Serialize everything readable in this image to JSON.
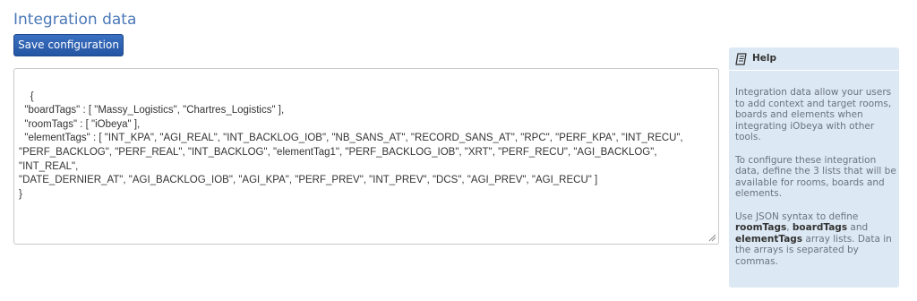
{
  "page": {
    "title": "Integration data"
  },
  "toolbar": {
    "save_label": "Save configuration"
  },
  "editor": {
    "value": "{\n  \"boardTags\" : [ \"Massy_Logistics\", \"Chartres_Logistics\" ],\n  \"roomTags\" : [ \"iObeya\" ],\n  \"elementTags\" : [ \"INT_KPA\", \"AGI_REAL\", \"INT_BACKLOG_IOB\", \"NB_SANS_AT\", \"RECORD_SANS_AT\", \"RPC\", \"PERF_KPA\", \"INT_RECU\",\n\"PERF_BACKLOG\", \"PERF_REAL\", \"INT_BACKLOG\", \"elementTag1\", \"PERF_BACKLOG_IOB\", \"XRT\", \"PERF_RECU\", \"AGI_BACKLOG\", \"INT_REAL\",\n\"DATE_DERNIER_AT\", \"AGI_BACKLOG_IOB\", \"AGI_KPA\", \"PERF_PREV\", \"INT_PREV\", \"DCS\", \"AGI_PREV\", \"AGI_RECU\" ]\n}"
  },
  "help": {
    "title": "Help",
    "icon": "book-icon",
    "paragraph1": "Integration data allow your users to add context and target rooms, boards and elements when integrating iObeya with other tools.",
    "paragraph2": "To configure these integration data, define the 3 lists that will be available for rooms, boards and elements.",
    "paragraph3_prefix": "Use JSON syntax to define ",
    "key_room": "roomTags",
    "sep1": ", ",
    "key_board": "boardTags",
    "sep2": " and ",
    "key_element": "elementTags",
    "paragraph3_suffix": " array lists. Data in the arrays is separated by commas."
  },
  "colors": {
    "accent": "#4a78b7",
    "button": "#2c5fb0",
    "help_bg": "#dce8f3"
  }
}
